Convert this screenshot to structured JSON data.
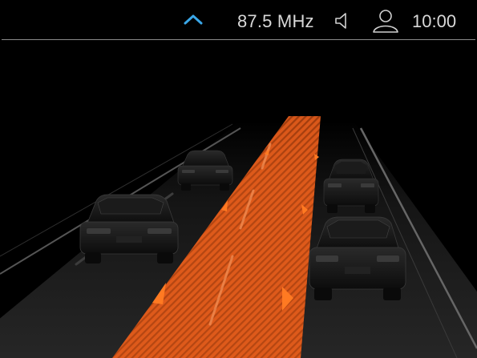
{
  "status_bar": {
    "radio_frequency": "87.5 MHz",
    "clock": "10:00",
    "icons": {
      "expand": "chevron-up-icon",
      "volume": "speaker-icon",
      "profile": "user-icon"
    },
    "accent_color": "#3aa7e8"
  },
  "driver_assist": {
    "view": "lane-change-assistant",
    "highlight_color": "#e8601c",
    "vehicles": [
      {
        "lane": "left",
        "position": "near"
      },
      {
        "lane": "left",
        "position": "far"
      },
      {
        "lane": "right",
        "position": "near"
      },
      {
        "lane": "right",
        "position": "far"
      }
    ]
  }
}
